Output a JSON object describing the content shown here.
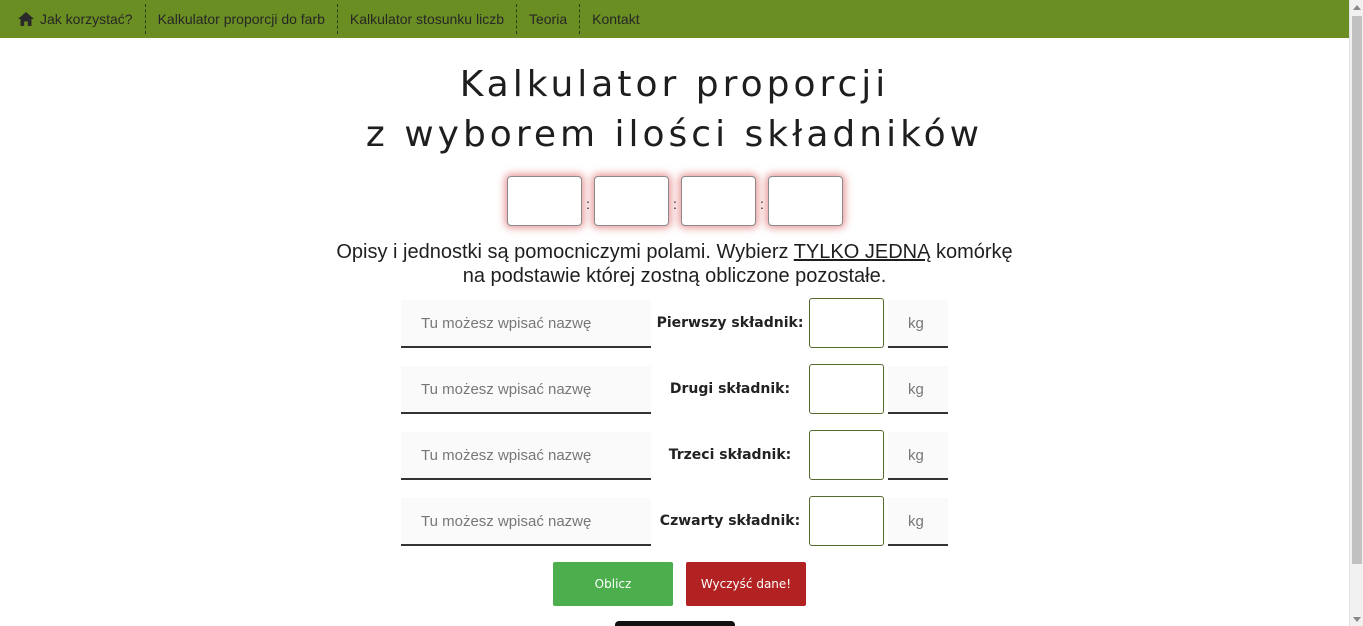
{
  "nav": {
    "items": [
      {
        "label": "Jak korzystać?",
        "icon": "home-icon"
      },
      {
        "label": "Kalkulator proporcji do farb"
      },
      {
        "label": "Kalkulator stosunku liczb"
      },
      {
        "label": "Teoria"
      },
      {
        "label": "Kontakt"
      }
    ],
    "background_color": "#6b8e23"
  },
  "title": {
    "line1": "Kalkulator proporcji",
    "line2": "z wyborem ilości składników"
  },
  "ratio": {
    "separator": ":",
    "values": [
      "",
      "",
      "",
      ""
    ]
  },
  "instructions": {
    "line1_before": "Opisy i jednostki są pomocniczymi polami. Wybierz ",
    "line1_emphasis": "TYLKO JEDNĄ",
    "line1_after": " komórkę",
    "line2": "na podstawie której zostną obliczone pozostałe."
  },
  "ingredients": [
    {
      "name_placeholder": "Tu możesz wpisać nazwę",
      "label": "Pierwszy składnik:",
      "value": "",
      "unit_placeholder": "kg"
    },
    {
      "name_placeholder": "Tu możesz wpisać nazwę",
      "label": "Drugi składnik:",
      "value": "",
      "unit_placeholder": "kg"
    },
    {
      "name_placeholder": "Tu możesz wpisać nazwę",
      "label": "Trzeci składnik:",
      "value": "",
      "unit_placeholder": "kg"
    },
    {
      "name_placeholder": "Tu możesz wpisać nazwę",
      "label": "Czwarty składnik:",
      "value": "",
      "unit_placeholder": "kg"
    }
  ],
  "buttons": {
    "calculate": "Oblicz",
    "clear": "Wyczyść dane!",
    "calculate_color": "#4cae4c",
    "clear_color": "#b22222"
  }
}
